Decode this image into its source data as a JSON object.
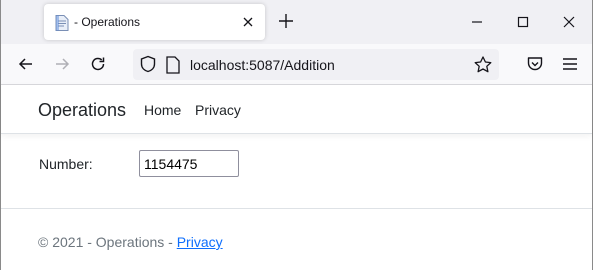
{
  "browser": {
    "tab": {
      "title": "- Operations",
      "icon": "page-icon"
    },
    "url": "localhost:5087/Addition",
    "icons": {
      "back": "arrow-left-icon",
      "forward": "arrow-right-icon",
      "reload": "reload-icon",
      "shield": "shield-icon",
      "bookmark": "star-icon",
      "pocket": "pocket-icon",
      "menu": "hamburger-icon",
      "new_tab": "plus-icon",
      "minimize": "minimize-icon",
      "maximize": "maximize-icon",
      "close": "close-icon"
    }
  },
  "navbar": {
    "brand": "Operations",
    "links": [
      "Home",
      "Privacy"
    ]
  },
  "form": {
    "label": "Number:",
    "value": "1154475"
  },
  "footer": {
    "text": "© 2021 - Operations - ",
    "link": "Privacy"
  },
  "colors": {
    "tabstrip_bg": "#f0f0f4",
    "toolbar_bg": "#f9f9fb",
    "link": "#0d6efd",
    "muted_text": "#6c757d"
  }
}
